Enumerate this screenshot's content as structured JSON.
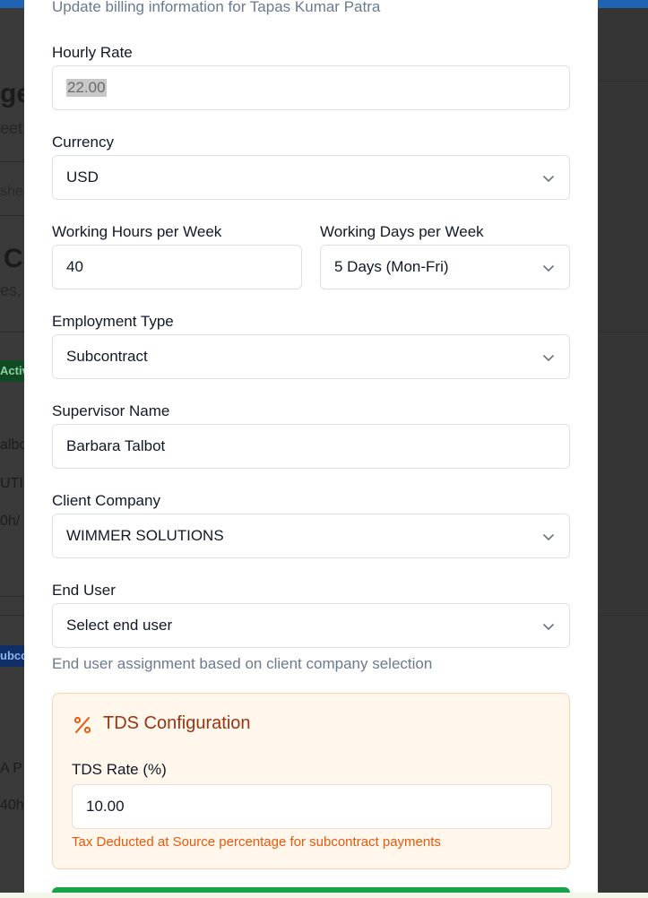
{
  "modal": {
    "description": "Update billing information for Tapas Kumar Patra",
    "hourly_rate": {
      "label": "Hourly Rate",
      "value": "22.00"
    },
    "currency": {
      "label": "Currency",
      "value": "USD"
    },
    "working_hours": {
      "label": "Working Hours per Week",
      "value": "40"
    },
    "working_days": {
      "label": "Working Days per Week",
      "value": "5 Days (Mon-Fri)"
    },
    "employment_type": {
      "label": "Employment Type",
      "value": "Subcontract"
    },
    "supervisor": {
      "label": "Supervisor Name",
      "value": "Barbara Talbot"
    },
    "client_company": {
      "label": "Client Company",
      "value": "WIMMER SOLUTIONS"
    },
    "end_user": {
      "label": "End User",
      "placeholder": "Select end user",
      "hint": "End user assignment based on client company selection"
    },
    "tds": {
      "title": "TDS Configuration",
      "icon": "percent-icon",
      "rate_label": "TDS Rate (%)",
      "rate_value": "10.00",
      "hint": "Tax Deducted at Source percentage for subcontract payments"
    }
  },
  "background": {
    "heading": "ge",
    "sub": "eet",
    "tab": "she",
    "heading2": "C",
    "sub2": "es, ",
    "badge1": "Activ",
    "row1": "albo",
    "row2": "UTI",
    "row3": "0h/",
    "badge2": "ubco",
    "row4": "A P",
    "row5": "40h"
  },
  "colors": {
    "accent_blue": "#1f63b5",
    "tds_title": "#9a3412",
    "tds_hint": "#ea580c",
    "save_green": "#16a34a"
  }
}
